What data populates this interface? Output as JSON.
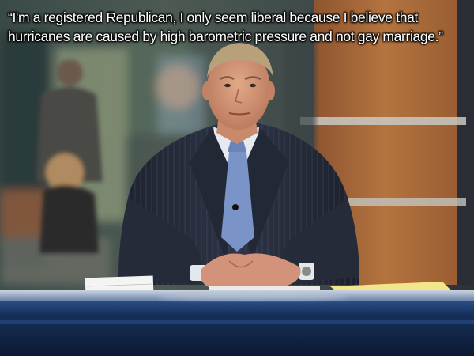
{
  "quote": {
    "line1": "“I'm a registered Republican, I only seem liberal because I believe that",
    "line2": "hurricanes are caused by high barometric pressure and not gay marriage.”"
  },
  "colors": {
    "text": "#ffffff",
    "desk": "#1f3a66",
    "suit": "#252a38",
    "tie": "#7a94c8",
    "wood_panel": "#a86a3c"
  }
}
